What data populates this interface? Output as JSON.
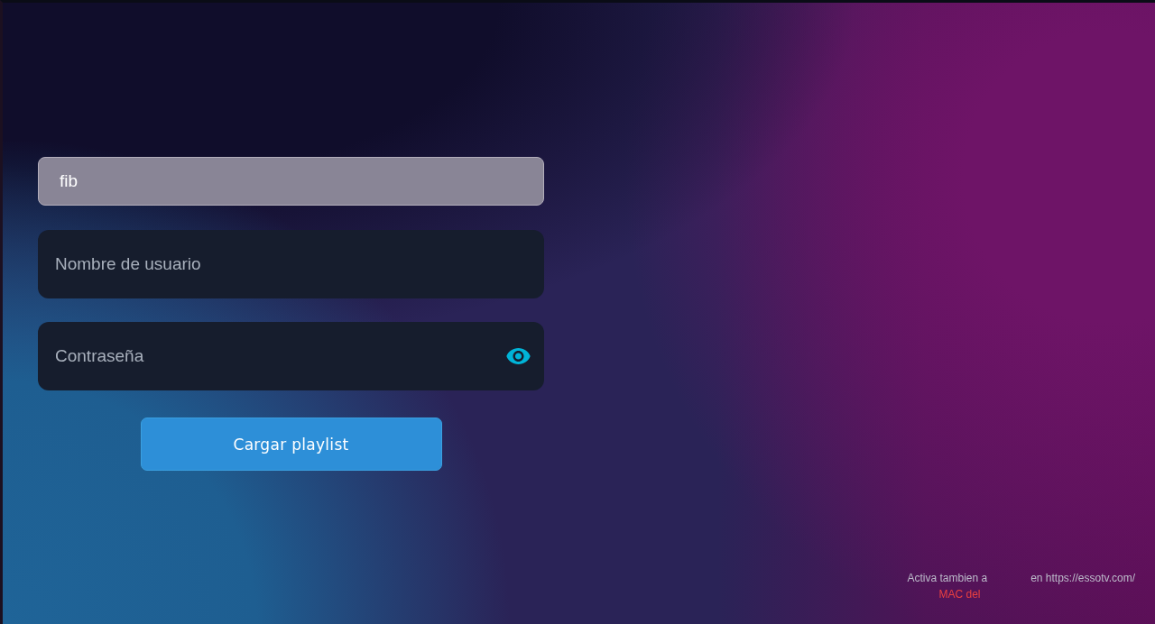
{
  "form": {
    "fields": [
      {
        "kind": "text",
        "value": "fib",
        "focused": true
      },
      {
        "kind": "text",
        "placeholder": "Nombre de usuario",
        "focused": false
      },
      {
        "kind": "password",
        "placeholder": "Contraseña",
        "focused": false
      }
    ],
    "submit_button": "Cargar playlist"
  },
  "notice": [
    {
      "kind": "info",
      "fragments": [
        "Activa tambien a",
        "en https://essotv.com/"
      ]
    },
    {
      "kind": "alert",
      "fragments": [
        "MAC del"
      ]
    }
  ]
}
